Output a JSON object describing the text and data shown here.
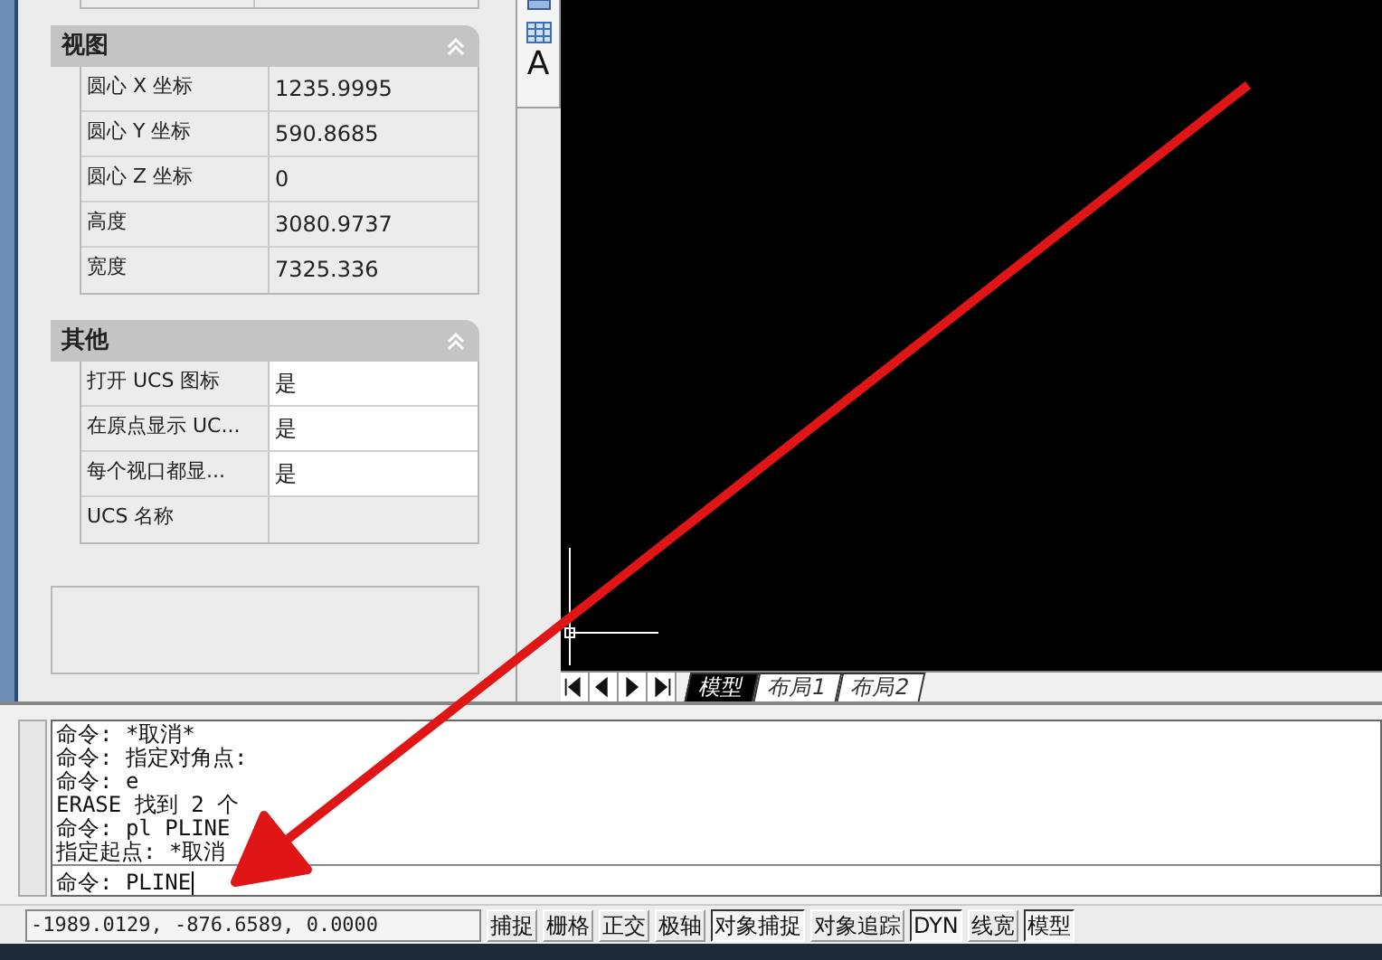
{
  "properties": {
    "sections": [
      {
        "title": "视图",
        "expanded": true,
        "rows": [
          {
            "label": "圆心 X 坐标",
            "value": "1235.9995",
            "editable": false
          },
          {
            "label": "圆心 Y 坐标",
            "value": "590.8685",
            "editable": false
          },
          {
            "label": "圆心 Z 坐标",
            "value": "0",
            "editable": false
          },
          {
            "label": "高度",
            "value": "3080.9737",
            "editable": false
          },
          {
            "label": "宽度",
            "value": "7325.336",
            "editable": false
          }
        ]
      },
      {
        "title": "其他",
        "expanded": true,
        "rows": [
          {
            "label": "打开 UCS 图标",
            "value": "是",
            "editable": true
          },
          {
            "label": "在原点显示 UC...",
            "value": "是",
            "editable": true
          },
          {
            "label": "每个视口都显...",
            "value": "是",
            "editable": true
          },
          {
            "label": "UCS 名称",
            "editable": false
          }
        ]
      }
    ]
  },
  "toolbar": {
    "text_tool": "A"
  },
  "layout_tabs": [
    {
      "label": "模型",
      "selected": true
    },
    {
      "label": "布局1",
      "selected": false
    },
    {
      "label": "布局2",
      "selected": false
    }
  ],
  "command_history": [
    "命令: *取消*",
    "命令: 指定对角点:",
    "命令: e",
    "ERASE 找到 2 个",
    "命令: pl PLINE",
    "指定起点: *取消"
  ],
  "command_input": "命令: PLINE",
  "status_bar": {
    "coordinates": "-1989.0129, -876.6589, 0.0000",
    "toggles": [
      {
        "label": "捕捉",
        "on": false
      },
      {
        "label": "栅格",
        "on": false
      },
      {
        "label": "正交",
        "on": false
      },
      {
        "label": "极轴",
        "on": false
      },
      {
        "label": "对象捕捉",
        "on": true
      },
      {
        "label": "对象追踪",
        "on": false
      },
      {
        "label": "DYN",
        "on": true
      },
      {
        "label": "线宽",
        "on": false
      },
      {
        "label": "模型",
        "on": true
      }
    ]
  }
}
